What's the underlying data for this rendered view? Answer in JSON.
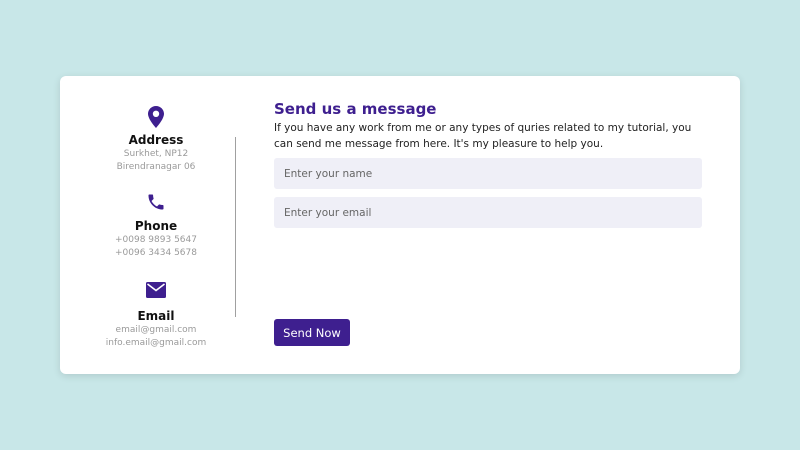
{
  "contact_info": {
    "address": {
      "title": "Address",
      "lines": [
        "Surkhet, NP12",
        "Birendranagar 06"
      ],
      "icon": "location-pin-icon"
    },
    "phone": {
      "title": "Phone",
      "lines": [
        "+0098 9893 5647",
        "+0096 3434 5678"
      ],
      "icon": "phone-icon"
    },
    "email": {
      "title": "Email",
      "lines": [
        "email@gmail.com",
        "info.email@gmail.com"
      ],
      "icon": "envelope-icon"
    }
  },
  "form": {
    "heading": "Send us a message",
    "description": "If you have any work from me or any types of quries related to my tutorial, you can send me message from here. It's my pleasure to help you.",
    "name_placeholder": "Enter your name",
    "email_placeholder": "Enter your email",
    "submit_label": "Send Now"
  },
  "colors": {
    "page_background": "#c8e7e8",
    "card_background": "#ffffff",
    "accent": "#3e1f8f",
    "input_background": "#efeff7",
    "muted_text": "#9a9a9a"
  }
}
